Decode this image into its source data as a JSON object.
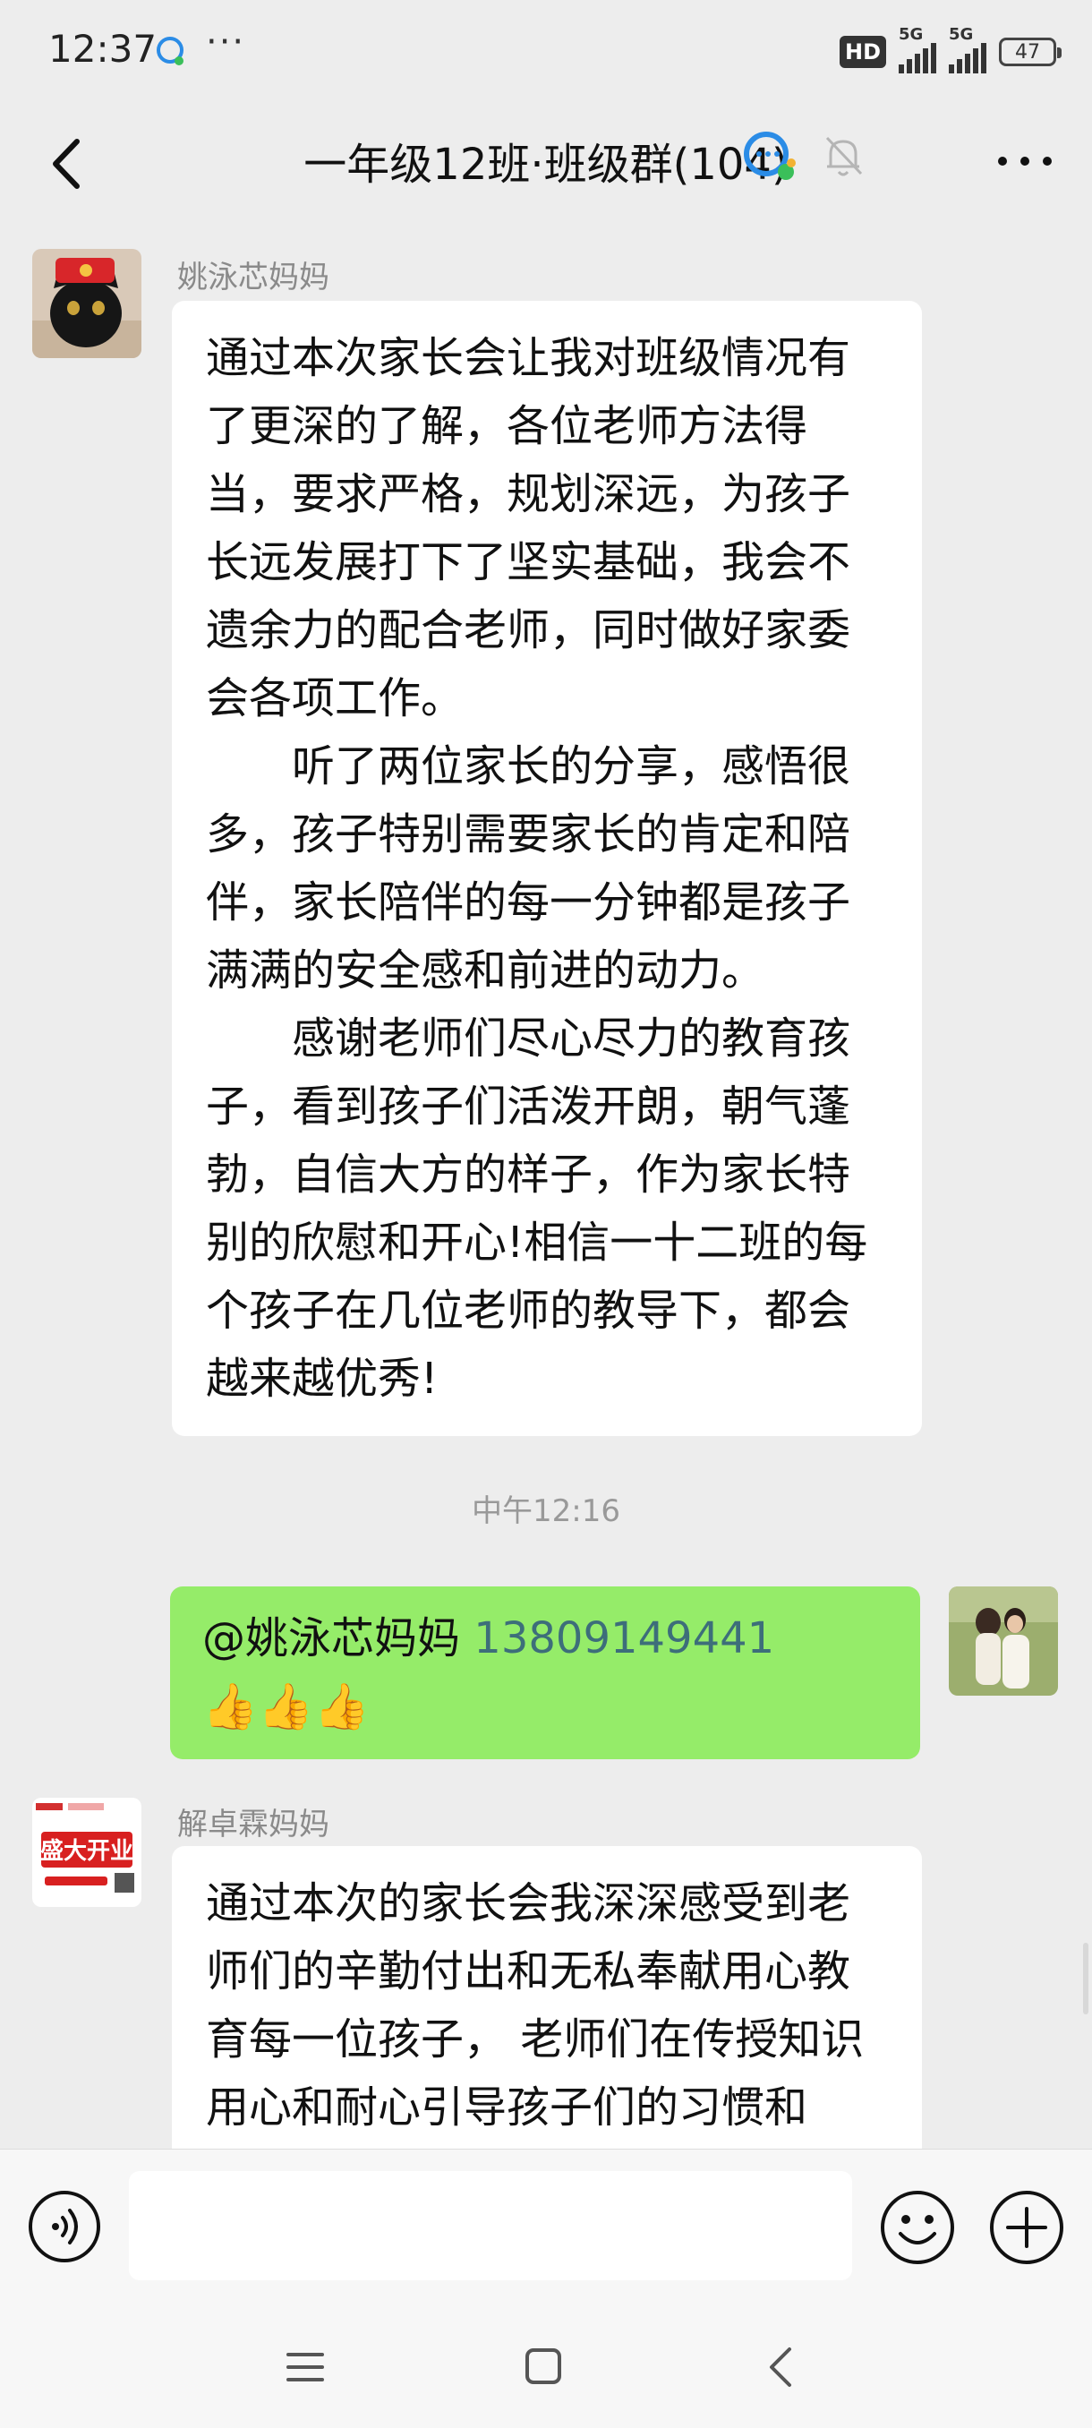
{
  "status_bar": {
    "time": "12:37",
    "dots": "···",
    "hd_label": "HD",
    "signal1_label": "5G",
    "signal2_label": "5G",
    "battery": "47"
  },
  "header": {
    "title": "一年级12班·班级群(104)",
    "back_icon": "chevron-left-icon",
    "logo_icon": "chat-bubbles-icon",
    "mute_icon": "bell-muted-icon",
    "more_icon": "more-horizontal-icon"
  },
  "messages": {
    "m1": {
      "sender": "姚泳芯妈妈",
      "p1": "通过本次家长会让我对班级情况有了更深的了解，各位老师方法得当，要求严格，规划深远，为孩子长远发展打下了坚实基础，我会不遗余力的配合老师，同时做好家委会各项工作。",
      "p2": "听了两位家长的分享，感悟很多，孩子特别需要家长的肯定和陪伴，家长陪伴的每一分钟都是孩子满满的安全感和前进的动力。",
      "p3": "感谢老师们尽心尽力的教育孩子，看到孩子们活泼开朗，朝气蓬勃，自信大方的样子，作为家长特别的欣慰和开心!相信一十二班的每个孩子在几位老师的教导下，都会越来越优秀!"
    },
    "time_separator": "中午12:16",
    "m2": {
      "mention": "@姚泳芯妈妈",
      "phone": "13809149441",
      "emoji": "👍👍👍"
    },
    "m3": {
      "sender": "解卓霖妈妈",
      "avatar_text": "盛大开业",
      "text": "通过本次的家长会我深深感受到老师们的辛勤付出和无私奉献用心教育每一位孩子， 老师们在传授知识用心和耐心引导孩子们的习惯和"
    }
  },
  "input_bar": {
    "placeholder": "",
    "voice_icon": "voice-icon",
    "emoji_icon": "emoji-icon",
    "plus_icon": "plus-icon"
  },
  "nav_bar": {
    "menu_icon": "menu-icon",
    "home_icon": "home-icon",
    "back_icon": "back-icon"
  }
}
